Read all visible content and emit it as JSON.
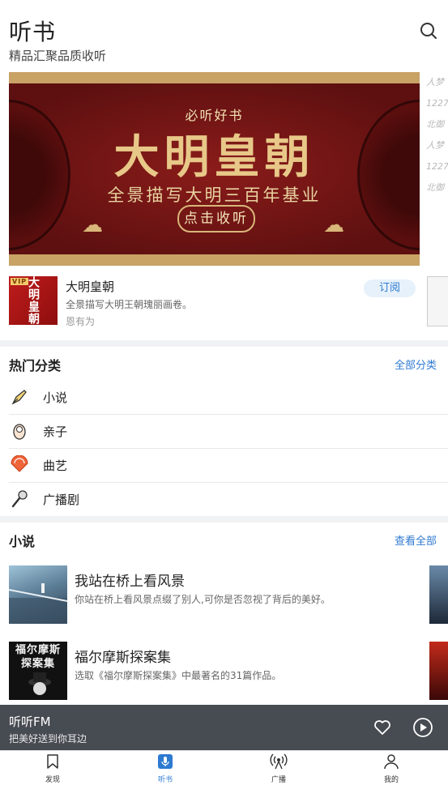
{
  "header": {
    "title": "听书",
    "subtitle": "精品汇聚品质收听",
    "search_icon": "search-icon"
  },
  "banner": {
    "kicker": "必听好书",
    "headline": "大明皇朝",
    "tagline": "全景描写大明三百年基业",
    "cta": "点击收听",
    "side_text": "人梦1227北御人梦1227北御"
  },
  "featured": {
    "cover_text": "大明皇朝",
    "vip_badge": "VIP",
    "title": "大明皇朝",
    "description": "全景描写大明王朝瑰丽画卷。",
    "author": "恩有为",
    "subscribe_label": "订阅"
  },
  "categories": {
    "title": "热门分类",
    "all_label": "全部分类",
    "items": [
      {
        "label": "小说",
        "icon": "pen-icon"
      },
      {
        "label": "亲子",
        "icon": "baby-icon"
      },
      {
        "label": "曲艺",
        "icon": "fan-icon"
      },
      {
        "label": "广播剧",
        "icon": "microphone-icon"
      }
    ]
  },
  "novels": {
    "title": "小说",
    "view_all_label": "查看全部",
    "items": [
      {
        "title": "我站在桥上看风景",
        "description": "你站在桥上看风景点缀了别人,可你是否忽视了背后的美好。"
      },
      {
        "title": "福尔摩斯探案集",
        "description": "选取《福尔摩斯探案集》中最著名的31篇作品。",
        "cover_text": "福尔摩斯探案集"
      }
    ]
  },
  "player": {
    "title": "听听FM",
    "subtitle": "把美好送到你耳边"
  },
  "tabs": [
    {
      "label": "发现",
      "icon": "bookmark-icon"
    },
    {
      "label": "听书",
      "icon": "microphone-icon"
    },
    {
      "label": "广播",
      "icon": "radio-tower-icon"
    },
    {
      "label": "我的",
      "icon": "user-icon"
    }
  ],
  "colors": {
    "accent": "#2e7ad1",
    "player_bg": "#474b52",
    "banner_red": "#6e1414",
    "banner_gold": "#c9a266"
  }
}
